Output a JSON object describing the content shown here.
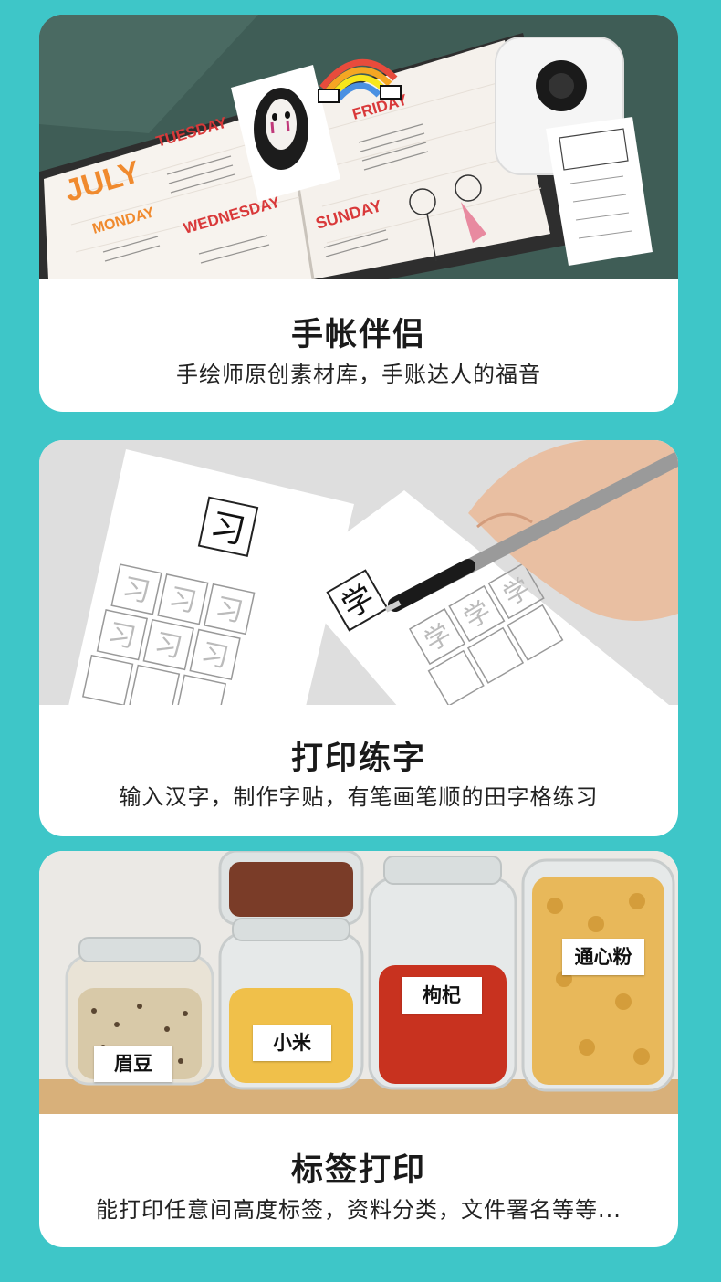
{
  "sections": [
    {
      "title": "手帐伴侣",
      "subtitle": "手绘师原创素材库，手账达人的福音",
      "photo": {
        "planner_headings": [
          "JULY",
          "TUESDAY",
          "MONDAY",
          "WEDNESDAY",
          "FRIDAY",
          "SUNDAY"
        ]
      }
    },
    {
      "title": "打印练字",
      "subtitle": "输入汉字，制作字贴，有笔画笔顺的田字格练习",
      "photo": {
        "practice_characters": [
          "习",
          "学"
        ]
      }
    },
    {
      "title": "标签打印",
      "subtitle": "能打印任意间高度标签，资料分类，文件署名等等...",
      "photo": {
        "jar_labels": [
          "眉豆",
          "小米",
          "枸杞",
          "通心粉"
        ]
      }
    }
  ],
  "colors": {
    "background": "#3ec6c8",
    "card": "#ffffff",
    "planner_bg": "#3f5d56",
    "planner_orange": "#f08a2e",
    "planner_red": "#d9393a"
  }
}
